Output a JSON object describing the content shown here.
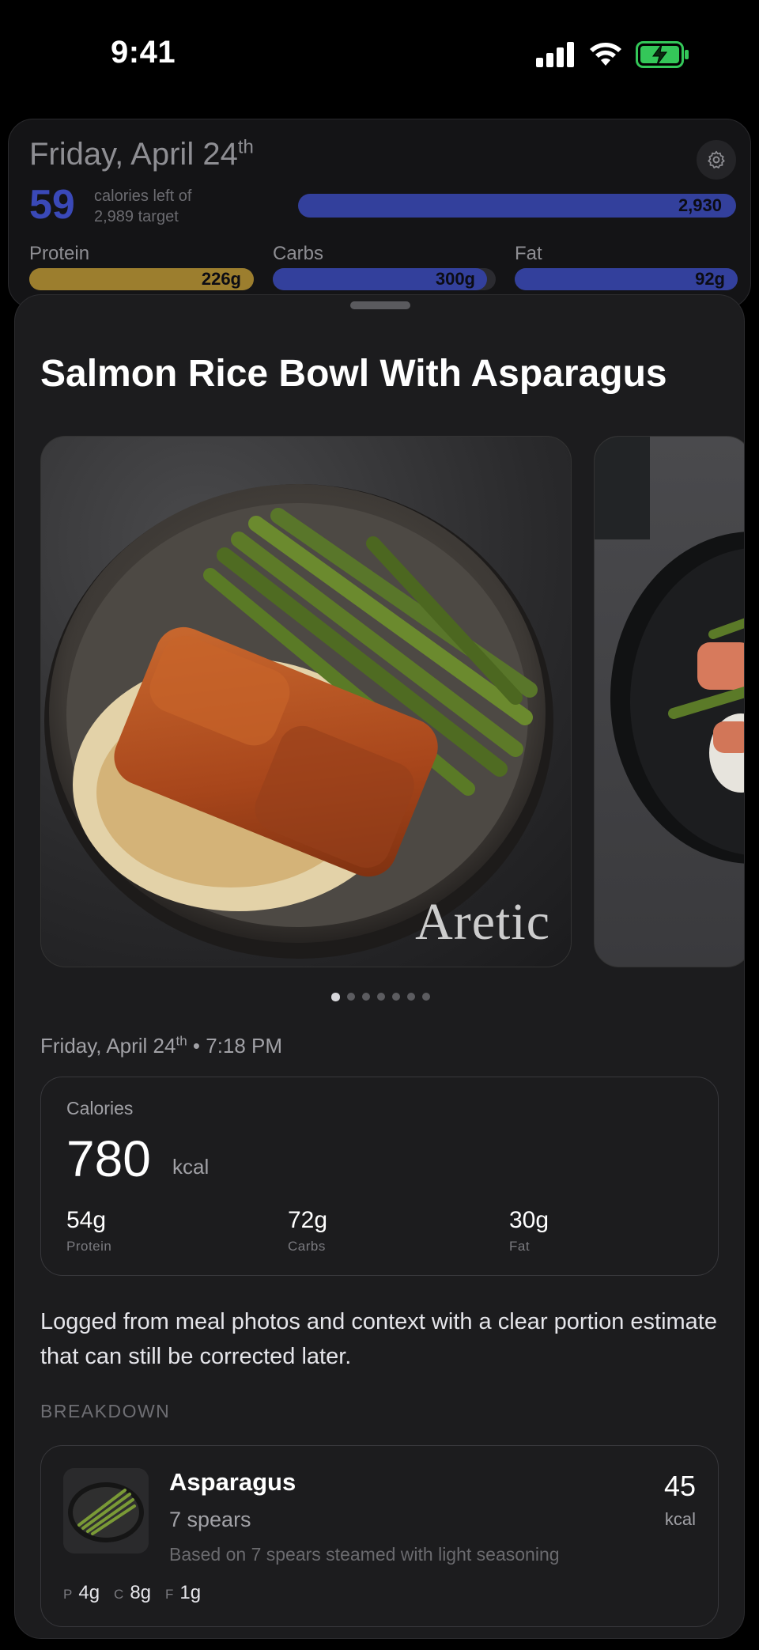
{
  "status_bar": {
    "time": "9:41"
  },
  "summary": {
    "date_main": "Friday, April 24",
    "date_suffix": "th",
    "calories_left": "59",
    "calories_desc_line1": "calories left of",
    "calories_desc_line2": "2,989 target",
    "calories_consumed": "2,930",
    "calories_progress": 0.98,
    "macros": [
      {
        "label": "Protein",
        "value": "226g",
        "progress": 1.0,
        "color": "#9c7e2e"
      },
      {
        "label": "Carbs",
        "value": "300g",
        "progress": 0.96,
        "color": "#33409c"
      },
      {
        "label": "Fat",
        "value": "92g",
        "progress": 1.0,
        "color": "#33409c"
      }
    ]
  },
  "meal": {
    "title": "Salmon Rice Bowl With Asparagus",
    "watermark": "Aretic",
    "photo_count": 7,
    "photo_active_index": 0,
    "date_main": "Friday, April 24",
    "date_suffix": "th",
    "time": "• 7:18 PM",
    "nutrition": {
      "label": "Calories",
      "calories": "780",
      "unit": "kcal",
      "macros": [
        {
          "value": "54g",
          "label": "Protein"
        },
        {
          "value": "72g",
          "label": "Carbs"
        },
        {
          "value": "30g",
          "label": "Fat"
        }
      ]
    },
    "note": "Logged from meal photos and context with a clear portion estimate that can still be corrected later.",
    "breakdown_header": "BREAKDOWN",
    "items": [
      {
        "name": "Asparagus",
        "quantity": "7 spears",
        "basis": "Based on 7 spears steamed with light seasoning",
        "kcal": "45",
        "kcal_unit": "kcal",
        "p_key": "P",
        "p_val": "4g",
        "c_key": "C",
        "c_val": "8g",
        "f_key": "F",
        "f_val": "1g"
      }
    ]
  },
  "colors": {
    "accent_blue": "#3a49b8",
    "protein_gold": "#9c7e2e",
    "battery_green": "#34c759"
  }
}
